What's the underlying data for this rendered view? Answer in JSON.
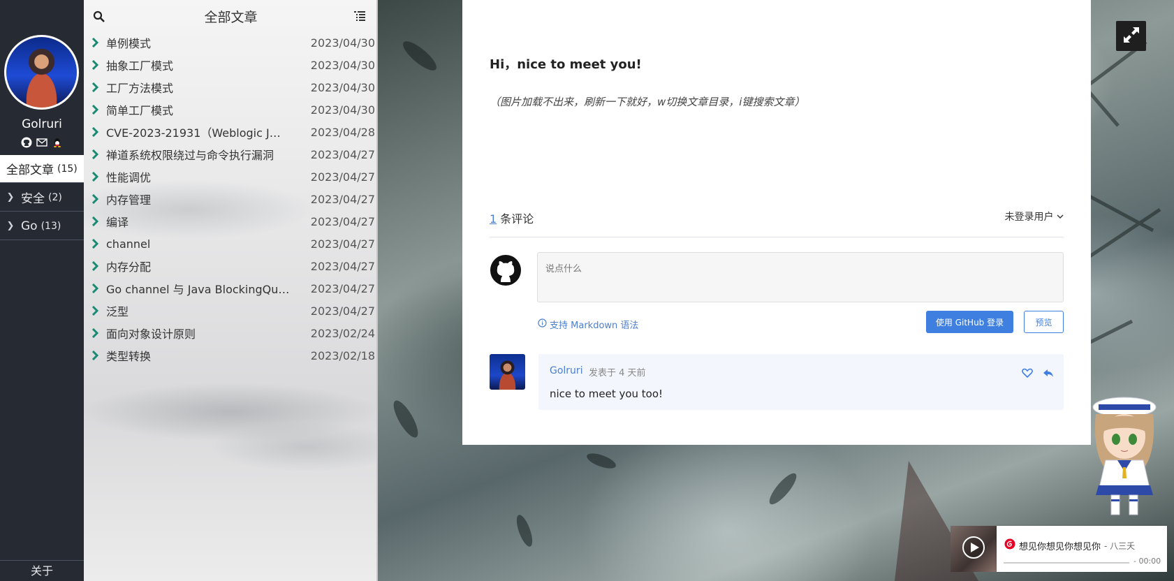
{
  "sidebar": {
    "user_name": "Golruri",
    "categories": [
      {
        "label": "全部文章",
        "count": "(15)"
      },
      {
        "label": "安全",
        "count": "(2)"
      },
      {
        "label": "Go",
        "count": "(13)"
      }
    ],
    "about": "关于",
    "social_icons": [
      "github-icon",
      "email-icon",
      "qq-icon"
    ]
  },
  "list": {
    "title": "全部文章",
    "articles": [
      {
        "title": "单例模式",
        "date": "2023/04/30"
      },
      {
        "title": "抽象工厂模式",
        "date": "2023/04/30"
      },
      {
        "title": "工厂方法模式",
        "date": "2023/04/30"
      },
      {
        "title": "简单工厂模式",
        "date": "2023/04/30"
      },
      {
        "title": "CVE-2023-21931（Weblogic J…",
        "date": "2023/04/28"
      },
      {
        "title": "禅道系统权限绕过与命令执行漏洞",
        "date": "2023/04/27"
      },
      {
        "title": "性能调优",
        "date": "2023/04/27"
      },
      {
        "title": "内存管理",
        "date": "2023/04/27"
      },
      {
        "title": "编译",
        "date": "2023/04/27"
      },
      {
        "title": "channel",
        "date": "2023/04/27"
      },
      {
        "title": "内存分配",
        "date": "2023/04/27"
      },
      {
        "title": "Go channel 与 Java BlockingQu…",
        "date": "2023/04/27"
      },
      {
        "title": "泛型",
        "date": "2023/04/27"
      },
      {
        "title": "面向对象设计原则",
        "date": "2023/02/24"
      },
      {
        "title": "类型转换",
        "date": "2023/02/18"
      }
    ]
  },
  "content": {
    "greeting": "Hi，nice to meet you!",
    "tip": "（图片加载不出来，刷新一下就好，w切换文章目录，i键搜索文章）"
  },
  "comments": {
    "count": "1",
    "count_suffix": " 条评论",
    "login_user": "未登录用户",
    "placeholder": "说点什么",
    "markdown_tip": "支持 Markdown 语法",
    "github_login": "使用 GitHub 登录",
    "preview": "预览",
    "items": [
      {
        "author": "Golruri",
        "meta": "发表于 4 天前",
        "body": "nice to meet you too!"
      }
    ]
  },
  "player": {
    "title": "想见你想见你想见你",
    "artist": "- 八三夭",
    "time": "- 00:00"
  },
  "colors": {
    "accent": "#3f7fe0",
    "sidebar_bg": "#262a33",
    "arrow_green": "#1a8a73"
  }
}
